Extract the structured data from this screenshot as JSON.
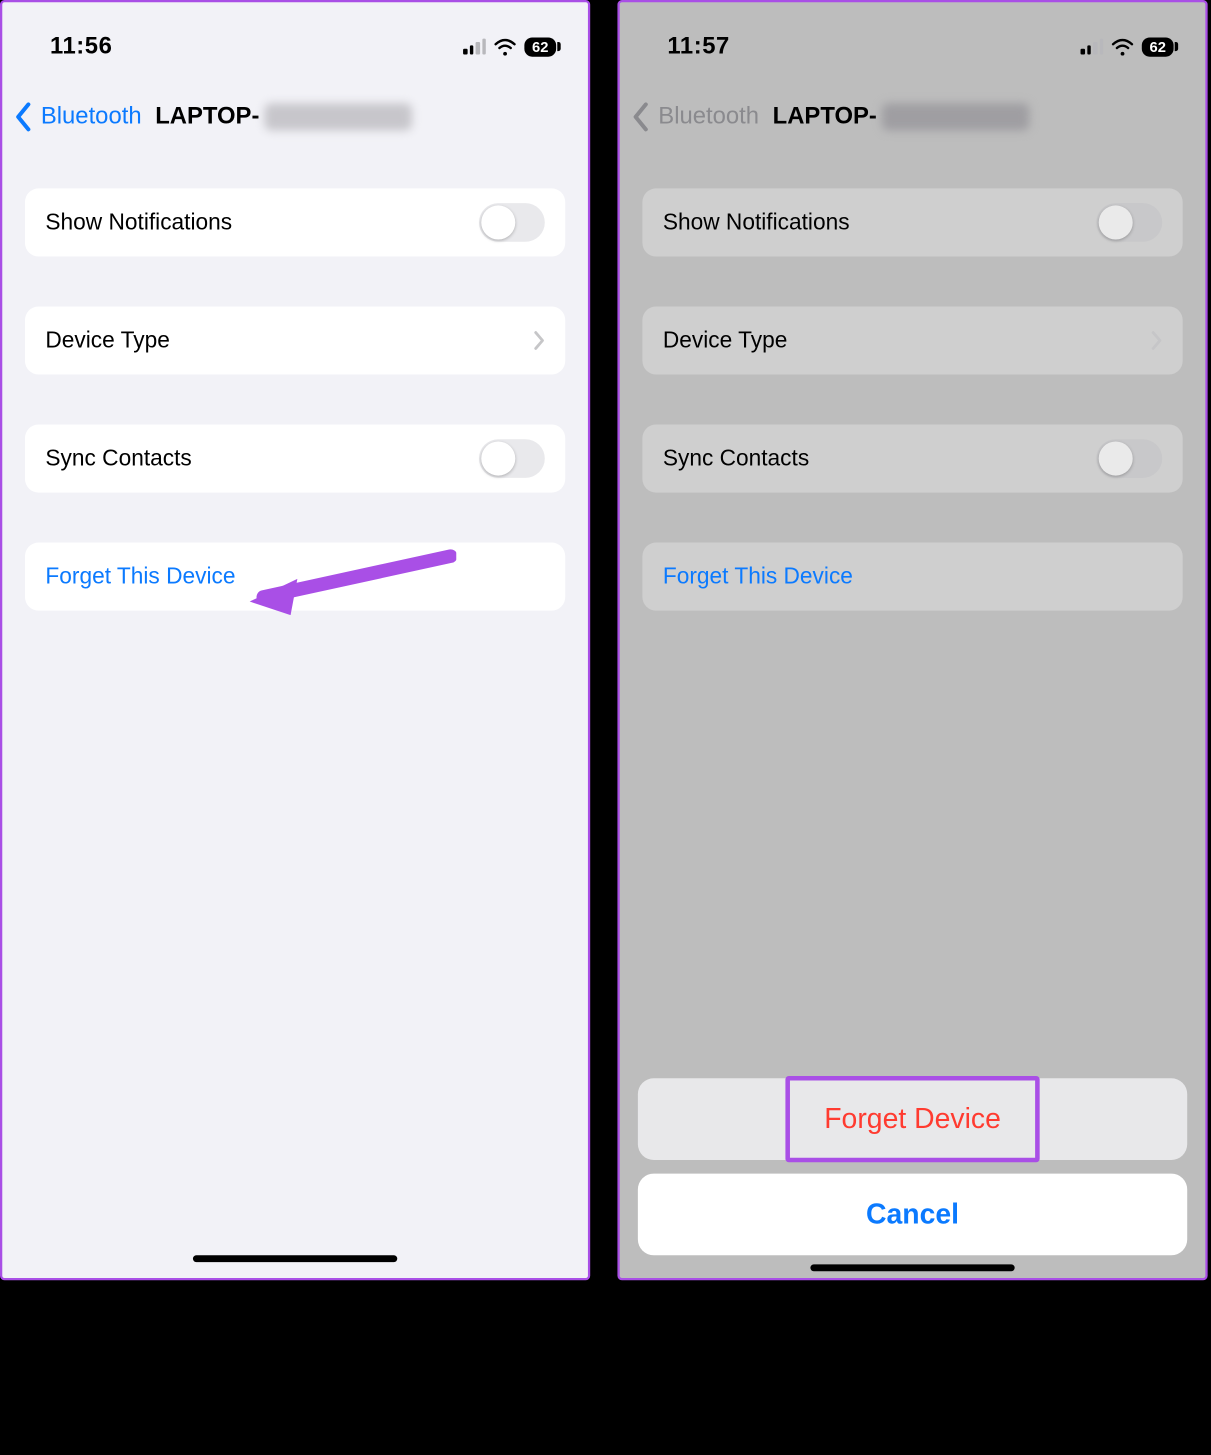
{
  "left": {
    "status": {
      "time": "11:56",
      "battery": "62"
    },
    "nav": {
      "back_label": "Bluetooth",
      "title_prefix": "LAPTOP-"
    },
    "rows": {
      "show_notifications": "Show Notifications",
      "device_type": "Device Type",
      "sync_contacts": "Sync Contacts",
      "forget": "Forget This Device"
    }
  },
  "right": {
    "status": {
      "time": "11:57",
      "battery": "62"
    },
    "nav": {
      "back_label": "Bluetooth",
      "title_prefix": "LAPTOP-"
    },
    "rows": {
      "show_notifications": "Show Notifications",
      "device_type": "Device Type",
      "sync_contacts": "Sync Contacts",
      "forget": "Forget This Device"
    },
    "sheet": {
      "forget": "Forget Device",
      "cancel": "Cancel"
    }
  },
  "colors": {
    "accent_blue": "#0b7aff",
    "destructive_red": "#ff3b30",
    "annotation_purple": "#a94fe6"
  }
}
